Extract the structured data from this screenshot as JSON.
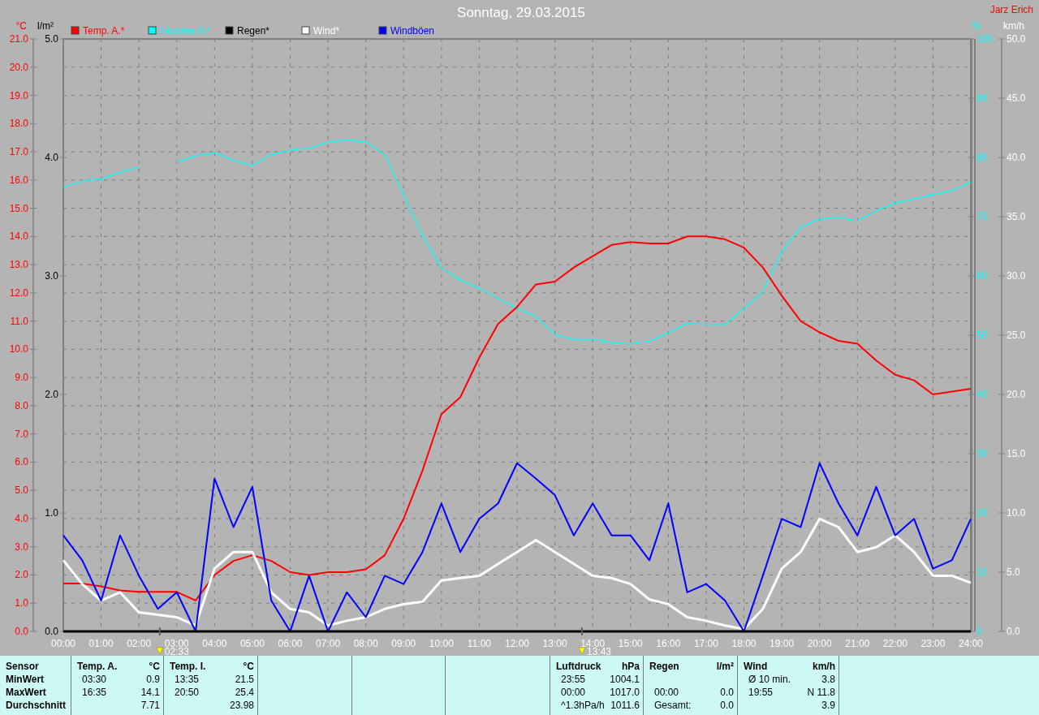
{
  "header": {
    "title": "Sonntag, 29.03.2015",
    "author": "Jarz Erich"
  },
  "chart": {
    "chart_data": {
      "type": "line",
      "xlim": [
        0,
        24
      ],
      "ylabel": "°C",
      "ylim": [
        0,
        21
      ],
      "x": [
        0,
        0.5,
        1,
        1.5,
        2,
        2.5,
        3,
        3.5,
        4,
        4.5,
        5,
        5.5,
        6,
        6.5,
        7,
        7.5,
        8,
        8.5,
        9,
        9.5,
        10,
        10.5,
        11,
        11.5,
        12,
        12.5,
        13,
        13.5,
        14,
        14.5,
        15,
        15.5,
        16,
        16.5,
        17,
        17.5,
        18,
        18.5,
        19,
        19.5,
        20,
        20.5,
        21,
        21.5,
        22,
        22.5,
        23,
        23.5,
        24
      ],
      "xticks": [
        {
          "value": 0,
          "label": "00:00"
        },
        {
          "value": 1,
          "label": "01:00"
        },
        {
          "value": 2,
          "label": "02:00"
        },
        {
          "value": 3,
          "label": "03:00"
        },
        {
          "value": 4,
          "label": "04:00"
        },
        {
          "value": 5,
          "label": "05:00"
        },
        {
          "value": 6,
          "label": "06:00"
        },
        {
          "value": 7,
          "label": "07:00"
        },
        {
          "value": 8,
          "label": "08:00"
        },
        {
          "value": 9,
          "label": "09:00"
        },
        {
          "value": 10,
          "label": "10:00"
        },
        {
          "value": 11,
          "label": "11:00"
        },
        {
          "value": 12,
          "label": "12:00"
        },
        {
          "value": 13,
          "label": "13:00"
        },
        {
          "value": 14,
          "label": "14:00"
        },
        {
          "value": 15,
          "label": "15:00"
        },
        {
          "value": 16,
          "label": "16:00"
        },
        {
          "value": 17,
          "label": "17:00"
        },
        {
          "value": 18,
          "label": "18:00"
        },
        {
          "value": 19,
          "label": "19:00"
        },
        {
          "value": 20,
          "label": "20:00"
        },
        {
          "value": 21,
          "label": "21:00"
        },
        {
          "value": 22,
          "label": "22:00"
        },
        {
          "value": 23,
          "label": "23:00"
        },
        {
          "value": 24,
          "label": "24:00"
        }
      ],
      "yticks": [
        {
          "value": 0,
          "label": "0.0"
        },
        {
          "value": 1,
          "label": "1.0"
        },
        {
          "value": 2,
          "label": "2.0"
        },
        {
          "value": 3,
          "label": "3.0"
        },
        {
          "value": 4,
          "label": "4.0"
        },
        {
          "value": 5,
          "label": "5.0"
        },
        {
          "value": 6,
          "label": "6.0"
        },
        {
          "value": 7,
          "label": "7.0"
        },
        {
          "value": 8,
          "label": "8.0"
        },
        {
          "value": 9,
          "label": "9.0"
        },
        {
          "value": 10,
          "label": "10.0"
        },
        {
          "value": 11,
          "label": "11.0"
        },
        {
          "value": 12,
          "label": "12.0"
        },
        {
          "value": 13,
          "label": "13.0"
        },
        {
          "value": 14,
          "label": "14.0"
        },
        {
          "value": 15,
          "label": "15.0"
        },
        {
          "value": 16,
          "label": "16.0"
        },
        {
          "value": 17,
          "label": "17.0"
        },
        {
          "value": 18,
          "label": "18.0"
        },
        {
          "value": 19,
          "label": "19.0"
        },
        {
          "value": 20,
          "label": "20.0"
        },
        {
          "value": 21,
          "label": "21.0"
        }
      ],
      "y2label": "%",
      "y2lim": [
        0,
        100
      ],
      "y2ticks": [
        {
          "value": 0,
          "label": "0"
        },
        {
          "value": 10,
          "label": "10"
        },
        {
          "value": 20,
          "label": "20"
        },
        {
          "value": 30,
          "label": "30"
        },
        {
          "value": 40,
          "label": "40"
        },
        {
          "value": 50,
          "label": "50"
        },
        {
          "value": 60,
          "label": "60"
        },
        {
          "value": 70,
          "label": "70"
        },
        {
          "value": 80,
          "label": "80"
        },
        {
          "value": 90,
          "label": "90"
        },
        {
          "value": 100,
          "label": "100"
        }
      ],
      "y3label": "km/h",
      "y3lim": [
        0,
        50
      ],
      "y3ticks": [
        {
          "value": 0,
          "label": "0.0"
        },
        {
          "value": 5,
          "label": "5.0"
        },
        {
          "value": 10,
          "label": "10.0"
        },
        {
          "value": 15,
          "label": "15.0"
        },
        {
          "value": 20,
          "label": "20.0"
        },
        {
          "value": 25,
          "label": "25.0"
        },
        {
          "value": 30,
          "label": "30.0"
        },
        {
          "value": 35,
          "label": "35.0"
        },
        {
          "value": 40,
          "label": "40.0"
        },
        {
          "value": 45,
          "label": "45.0"
        },
        {
          "value": 50,
          "label": "50.0"
        }
      ],
      "series": [
        {
          "name": "Temp. A.*",
          "color": "#ff0000",
          "values": [
            1.7,
            1.7,
            1.6,
            1.45,
            1.4,
            1.4,
            1.4,
            1.1,
            2.0,
            2.5,
            2.7,
            2.5,
            2.1,
            2.0,
            2.1,
            2.1,
            2.2,
            2.7,
            4.0,
            5.7,
            7.7,
            8.3,
            9.7,
            10.9,
            11.5,
            12.3,
            12.4,
            12.9,
            13.3,
            13.7,
            13.8,
            13.75,
            13.75,
            14.0,
            14.0,
            13.9,
            13.6,
            12.9,
            11.9,
            11.0,
            10.6,
            10.3,
            10.2,
            9.6,
            9.1,
            8.9,
            8.4,
            8.5,
            8.6
          ]
        },
        {
          "name": "Feuchte A.*",
          "color": "#00ffff",
          "axis": "y2",
          "values": [
            75,
            76,
            76.4,
            77.5,
            78.4,
            null,
            79.2,
            80.3,
            80.8,
            79.5,
            78.6,
            80.5,
            81.2,
            81.6,
            82.6,
            83,
            82.6,
            80.5,
            73.7,
            66.8,
            61.4,
            59.3,
            57.9,
            56.2,
            54.5,
            53.2,
            50.1,
            49.3,
            49.3,
            48.8,
            48.5,
            49,
            50.4,
            52,
            51.8,
            51.8,
            54.5,
            57.3,
            64.1,
            68.2,
            69.6,
            69.9,
            69.3,
            71,
            72.3,
            73,
            73.7,
            74.4,
            75.8
          ]
        },
        {
          "name": "Regen*",
          "color": "#000000",
          "values": [
            0,
            0,
            0,
            0,
            0,
            0,
            0,
            0,
            0,
            0,
            0,
            0,
            0,
            0,
            0,
            0,
            0,
            0,
            0,
            0,
            0,
            0,
            0,
            0,
            0,
            0,
            0,
            0,
            0,
            0,
            0,
            0,
            0,
            0,
            0,
            0,
            0,
            0,
            0,
            0,
            0,
            0,
            0,
            0,
            0,
            0,
            0,
            0,
            0
          ]
        },
        {
          "name": "Wind*",
          "color": "#ffffff",
          "axis": "y3",
          "values": [
            6.0,
            4.0,
            2.6,
            3.3,
            1.6,
            1.4,
            1.2,
            0.5,
            5.3,
            6.7,
            6.7,
            3.3,
            1.9,
            1.6,
            0.5,
            0.9,
            1.2,
            1.9,
            2.3,
            2.5,
            4.3,
            4.5,
            4.7,
            5.7,
            6.7,
            7.7,
            6.7,
            5.7,
            4.7,
            4.5,
            4.0,
            2.7,
            2.3,
            1.2,
            0.9,
            0.5,
            0.2,
            1.9,
            5.3,
            6.7,
            9.5,
            8.8,
            6.7,
            7.1,
            8.1,
            6.7,
            4.7,
            4.7,
            4.1
          ]
        },
        {
          "name": "Windböen",
          "color": "#0000ff",
          "axis": "y3",
          "values": [
            8.1,
            6.0,
            2.6,
            8.1,
            4.7,
            1.9,
            3.3,
            0,
            12.9,
            8.8,
            12.2,
            2.6,
            0,
            4.7,
            0,
            3.3,
            1.2,
            4.7,
            4.0,
            6.7,
            10.8,
            6.7,
            9.5,
            10.8,
            14.2,
            12.9,
            11.5,
            8.1,
            10.8,
            8.1,
            8.1,
            6.0,
            10.8,
            3.3,
            4.0,
            2.6,
            0,
            4.7,
            9.5,
            8.8,
            14.2,
            10.8,
            8.1,
            12.2,
            8.1,
            9.5,
            5.3,
            6.0,
            9.5
          ]
        }
      ],
      "annotations": [
        "02:33",
        "13:43"
      ],
      "grid": true,
      "legend": "top"
    },
    "rain_axis": {
      "unit": "l/m²",
      "ticks": [
        "5.0",
        "4.0",
        "3.0",
        "2.0",
        "1.0",
        "0.0"
      ]
    }
  },
  "summary": {
    "row_labels": [
      "Sensor",
      "MinWert",
      "MaxWert",
      "Durchschnitt"
    ],
    "panels": [
      {
        "kind": "sensor",
        "name": "Temp. A.",
        "unit": "°C",
        "rows": [
          {
            "time": "03:30",
            "value": "0.9"
          },
          {
            "time": "16:35",
            "value": "14.1"
          },
          {
            "value": "7.71"
          }
        ]
      },
      {
        "kind": "sensor",
        "name": "Temp. I.",
        "unit": "°C",
        "rows": [
          {
            "time": "13:35",
            "value": "21.5"
          },
          {
            "time": "20:50",
            "value": "25.4"
          },
          {
            "value": "23.98"
          }
        ]
      },
      {
        "kind": "empty"
      },
      {
        "kind": "empty"
      },
      {
        "kind": "empty"
      },
      {
        "kind": "sensor",
        "name": "Luftdruck",
        "unit": "hPa",
        "rows": [
          {
            "time": "23:55",
            "value": "1004.1"
          },
          {
            "time": "00:00",
            "value": "1017.0"
          },
          {
            "time": "^1.3hPa/h",
            "value": "1011.6"
          }
        ]
      },
      {
        "kind": "sensor",
        "name": "Regen",
        "unit": "l/m²",
        "rows": [
          null,
          {
            "time": "00:00",
            "value": "0.0"
          },
          {
            "time": "Gesamt:",
            "value": "0.0"
          }
        ]
      },
      {
        "kind": "sensor",
        "name": "Wind",
        "unit": "km/h",
        "rows": [
          {
            "time": "Ø 10 min.",
            "value": "3.8"
          },
          {
            "time": "19:55",
            "value": "N 11.8"
          },
          {
            "value": "3.9"
          }
        ]
      }
    ]
  }
}
